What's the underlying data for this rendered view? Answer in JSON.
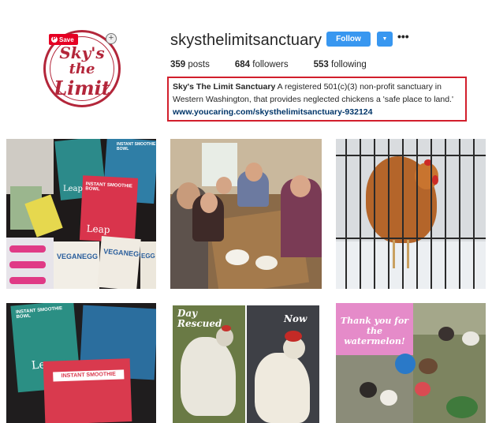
{
  "profile": {
    "logo_lines": [
      "Sky's",
      "the",
      "Limit"
    ],
    "pin_save_label": "Save",
    "username": "skysthelimitsanctuary",
    "follow_label": "Follow",
    "dropdown_icon": "caret-down-icon",
    "more_label": "•••",
    "stats": [
      {
        "count": "359",
        "label": " posts"
      },
      {
        "count": "684",
        "label": " followers"
      },
      {
        "count": "553",
        "label": " following"
      }
    ],
    "bio_name": "Sky's The Limit Sanctuary",
    "bio_text": " A registered 501(c)(3) non-profit sanctuary in Western Washington, that provides neglected chickens a 'safe place to land.'",
    "bio_link": "www.youcaring.com/skysthelimitsanctuary-932124"
  },
  "posts": {
    "t1": {
      "labels": [
        "INSTANT SMOOTHIE BOWL",
        "INSTANT SMOOTHIE BOWL",
        "Leap",
        "Leap",
        "VEGANEGG",
        "VEGANEGG",
        "EGG"
      ]
    },
    "t4": {
      "labels": [
        "INSTANT SMOOTHIE BOWL",
        "Leap",
        "INSTANT SMOOTHIE BOWL"
      ]
    },
    "t5": {
      "left_caption": "Day Rescued",
      "right_caption": "Now"
    },
    "t6": {
      "caption": "Thank you for the watermelon!"
    }
  },
  "colors": {
    "brand": "#b3263a",
    "follow": "#3897f0",
    "highlight_border": "#d21f2c",
    "link": "#003569",
    "pink_panel": "#e58bc9"
  }
}
